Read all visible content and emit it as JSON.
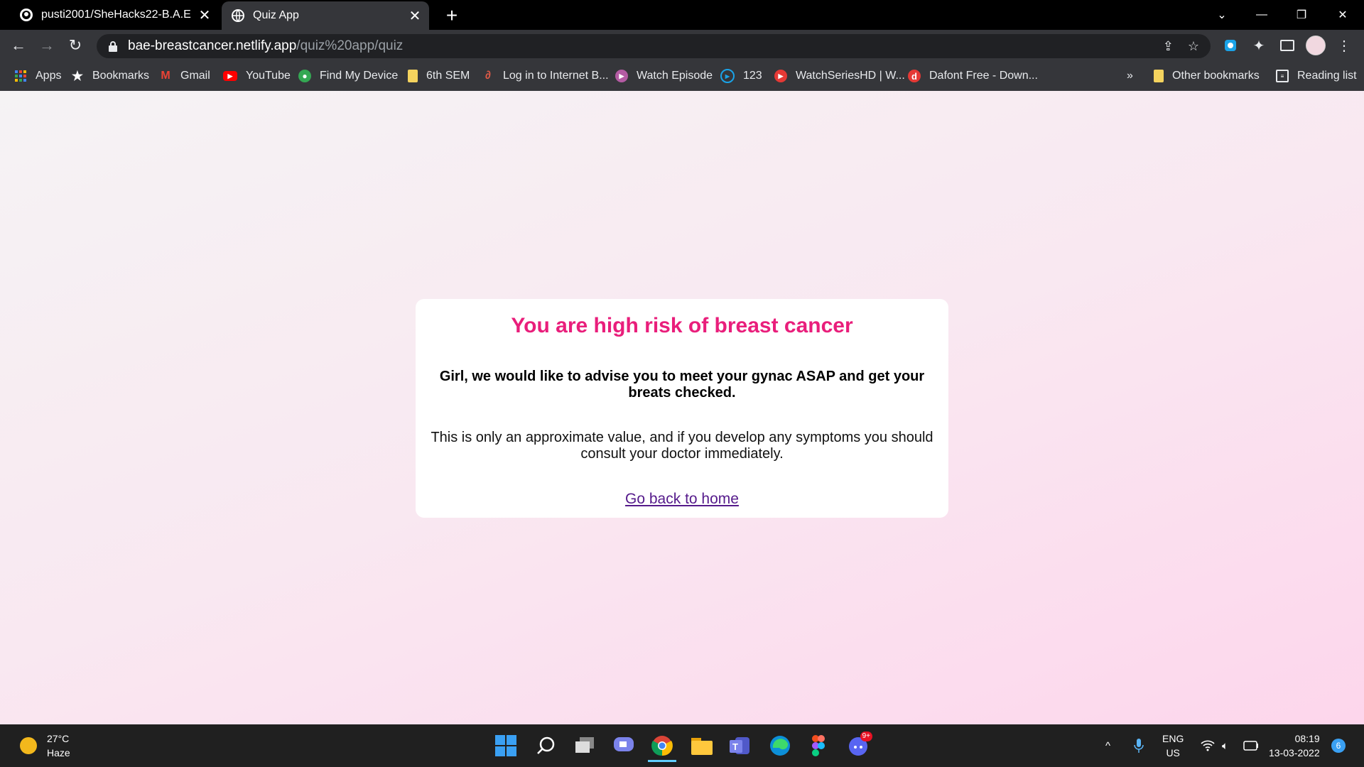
{
  "browser": {
    "tabs": [
      {
        "title": "pusti2001/SheHacks22-B.A.E",
        "active": false
      },
      {
        "title": "Quiz App",
        "active": true
      }
    ],
    "url_host": "bae-breastcancer.netlify.app",
    "url_path": "/quiz%20app/quiz"
  },
  "bookmarks": {
    "items": [
      {
        "label": "Apps",
        "icon": "apps-grid-icon"
      },
      {
        "label": "Bookmarks",
        "icon": "star-icon"
      },
      {
        "label": "Gmail",
        "icon": "gmail-icon"
      },
      {
        "label": "YouTube",
        "icon": "youtube-icon"
      },
      {
        "label": "Find My Device",
        "icon": "find-device-icon"
      },
      {
        "label": "6th SEM",
        "icon": "folder-icon"
      },
      {
        "label": "Log in to Internet B...",
        "icon": "link-icon"
      },
      {
        "label": "Watch Episode",
        "icon": "play-icon"
      },
      {
        "label": "123",
        "icon": "play-circle-icon"
      },
      {
        "label": "WatchSeriesHD | W...",
        "icon": "play-red-icon"
      },
      {
        "label": "Dafont Free - Down...",
        "icon": "dafont-icon"
      }
    ],
    "overflow": "»",
    "other": "Other bookmarks",
    "reading_list": "Reading list"
  },
  "result": {
    "heading": "You are high risk of breast cancer",
    "advice": "Girl, we would like to advise you to meet your gynac ASAP and get your breats checked.",
    "note": "This is only an approximate value, and if you develop any symptoms you should consult your doctor immediately.",
    "link": "Go back to home"
  },
  "colors": {
    "heading": "#e91e7b",
    "link": "#551a8b"
  },
  "taskbar": {
    "temperature": "27°C",
    "condition": "Haze",
    "lang_top": "ENG",
    "lang_bottom": "US",
    "time": "08:19",
    "date": "13-03-2022",
    "notification_count": "6",
    "discord_badge": "9+"
  }
}
